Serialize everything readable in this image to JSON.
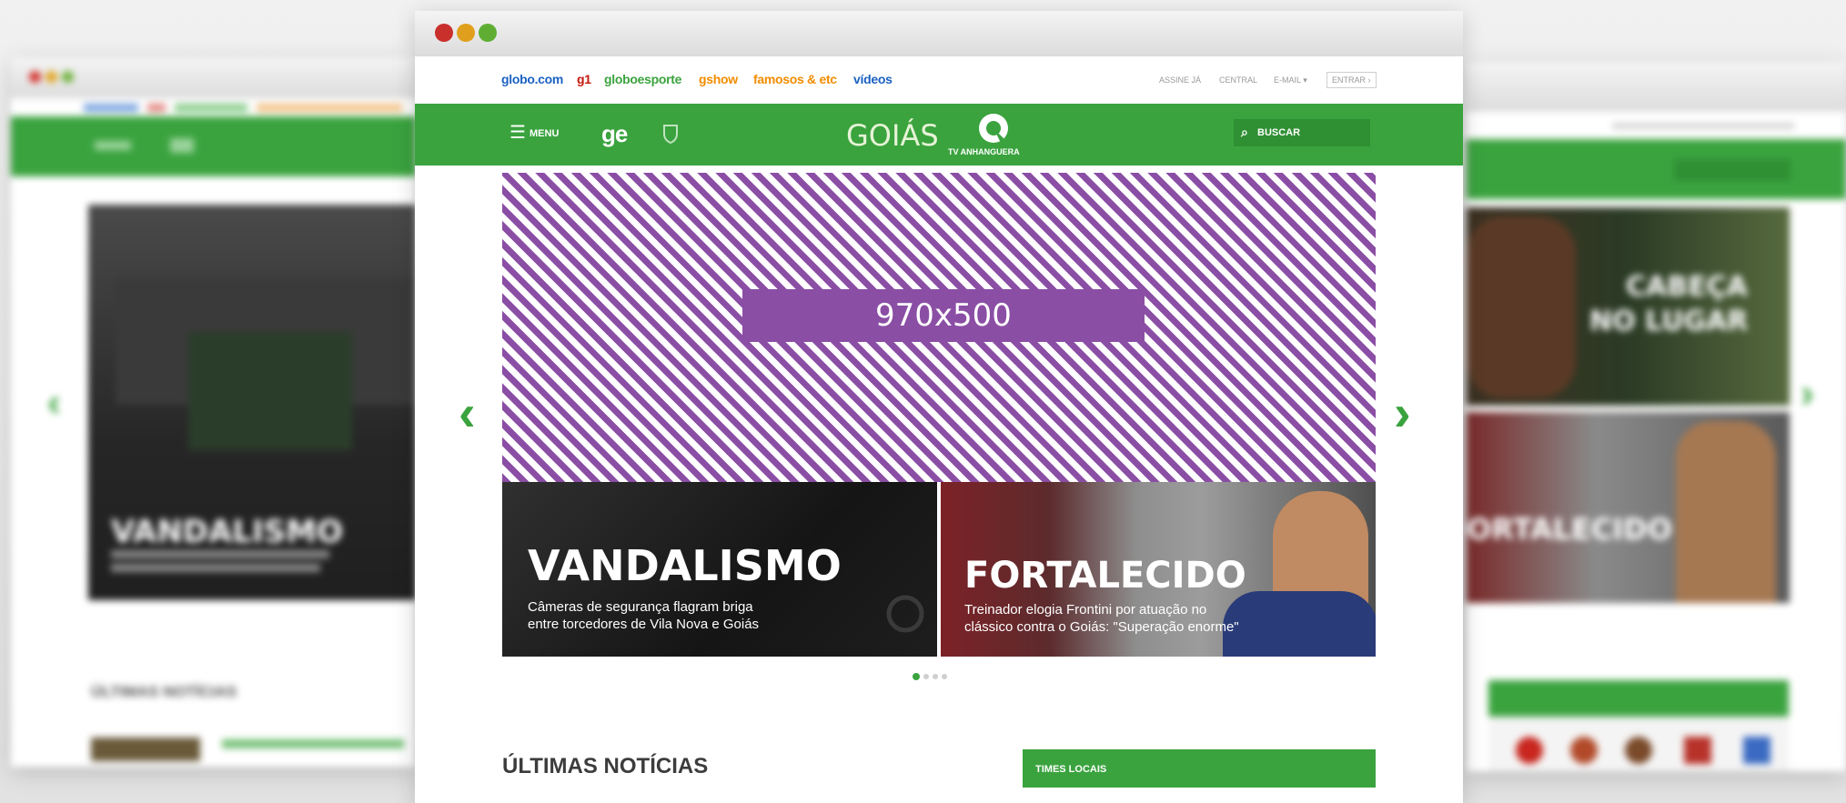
{
  "globo_bar": {
    "links": [
      {
        "label": "globo.com",
        "color": "#1b62c2"
      },
      {
        "label": "g1",
        "color": "#c4170c"
      },
      {
        "label": "globoesporte",
        "color": "#3aa33e"
      },
      {
        "label": "gshow",
        "color": "#f28c00"
      },
      {
        "label": "famosos & etc",
        "color": "#f28c00"
      },
      {
        "label": "vídeos",
        "color": "#1b62c2"
      }
    ],
    "right": {
      "assine": "ASSINE JÁ",
      "central": "CENTRAL",
      "email": "E-MAIL",
      "entrar": "ENTRAR"
    }
  },
  "header": {
    "menu_label": "MENU",
    "ge_logo": "ge",
    "title": "GOIÁS",
    "tv_name": "TV ANHANGUERA",
    "search_label": "BUSCAR",
    "color": "#3aa33e"
  },
  "ad": {
    "size_label": "970x500",
    "color": "#8b4ea5"
  },
  "stories": [
    {
      "title": "VANDALISMO",
      "subtitle_line1": "Câmeras de segurança flagram briga",
      "subtitle_line2": "entre torcedores de Vila Nova e Goiás"
    },
    {
      "title": "FORTALECIDO",
      "subtitle_line1": "Treinador elogia Frontini por atuação no",
      "subtitle_line2": "clássico contra o Goiás: \"Superação enorme\""
    }
  ],
  "pagination": {
    "total": 4,
    "active": 1
  },
  "latest_news": {
    "heading": "ÚLTIMAS NOTÍCIAS"
  },
  "local_teams": {
    "heading": "TIMES LOCAIS"
  },
  "side_left": {
    "story_title": "VANDALISMO",
    "latest_heading": "ÚLTIMAS NOTÍCIAS"
  },
  "side_right": {
    "story1_line1": "CABEÇA",
    "story1_line2": "NO LUGAR",
    "story2_title": "ORTALECIDO"
  }
}
